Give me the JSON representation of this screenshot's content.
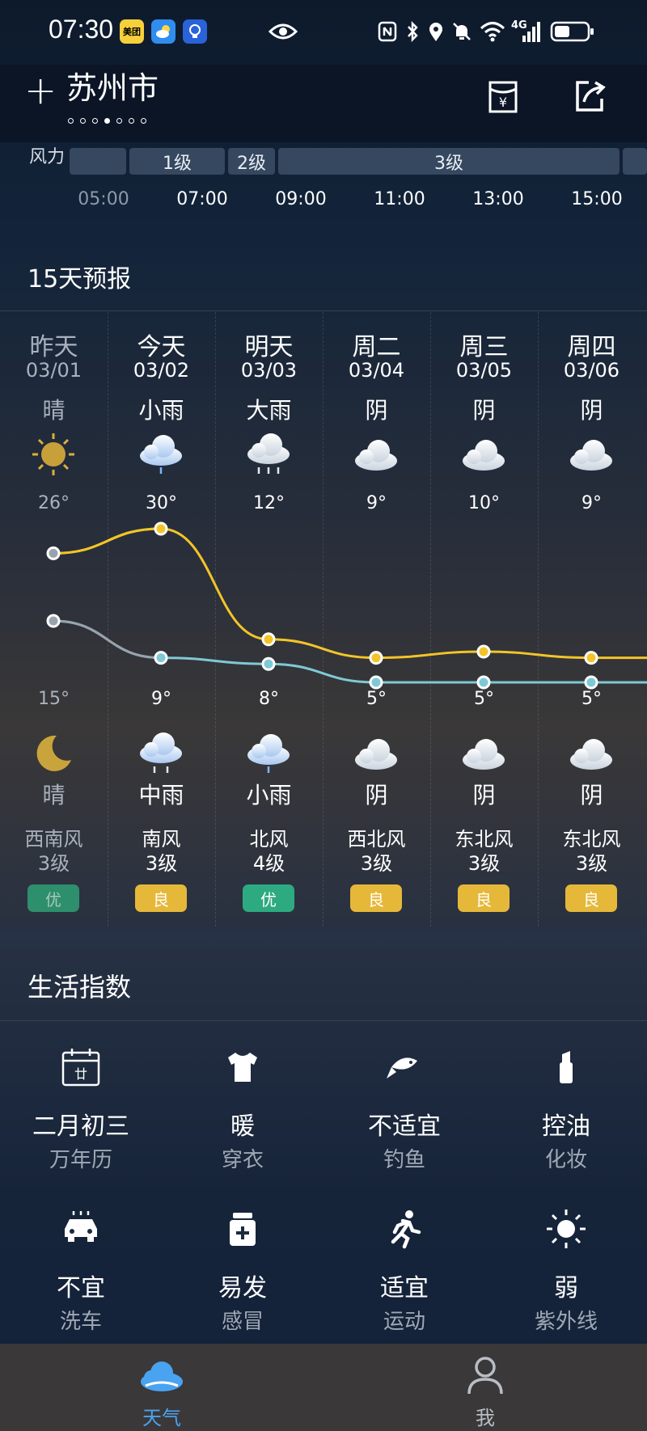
{
  "status_bar": {
    "time": "07:30",
    "apps": [
      "美团",
      "weather-app-icon",
      "bulb-app-icon"
    ],
    "icons": [
      "eye-icon",
      "nfc-icon",
      "bluetooth-icon",
      "location-icon",
      "mute-icon",
      "wifi-icon",
      "signal-4g-icon",
      "battery-icon"
    ],
    "network": "4G"
  },
  "header": {
    "city": "苏州市",
    "page_count": 7,
    "active_page": 3
  },
  "wind_strip": {
    "label": "风力",
    "levels": [
      "1级",
      "2级",
      "3级"
    ],
    "hours": [
      "05:00",
      "07:00",
      "09:00",
      "11:00",
      "13:00",
      "15:00"
    ]
  },
  "forecast": {
    "title": "15天预报",
    "days": [
      {
        "name": "昨天",
        "date": "03/01",
        "day_weather": "晴",
        "day_icon": "sun-icon",
        "high": "26°",
        "low": "15°",
        "night_icon": "moon-icon",
        "night_weather": "晴",
        "wind_dir": "西南风",
        "wind_level": "3级",
        "aqi": "优",
        "aqi_color": "#2e8f6c",
        "past": true
      },
      {
        "name": "今天",
        "date": "03/02",
        "day_weather": "小雨",
        "day_icon": "light-rain-icon",
        "high": "30°",
        "low": "9°",
        "night_icon": "moderate-rain-icon",
        "night_weather": "中雨",
        "wind_dir": "南风",
        "wind_level": "3级",
        "aqi": "良",
        "aqi_color": "#e6b83a",
        "past": false
      },
      {
        "name": "明天",
        "date": "03/03",
        "day_weather": "大雨",
        "day_icon": "heavy-rain-icon",
        "high": "12°",
        "low": "8°",
        "night_icon": "light-rain-icon",
        "night_weather": "小雨",
        "wind_dir": "北风",
        "wind_level": "4级",
        "aqi": "优",
        "aqi_color": "#2eaa80",
        "past": false
      },
      {
        "name": "周二",
        "date": "03/04",
        "day_weather": "阴",
        "day_icon": "overcast-icon",
        "high": "9°",
        "low": "5°",
        "night_icon": "overcast-icon",
        "night_weather": "阴",
        "wind_dir": "西北风",
        "wind_level": "3级",
        "aqi": "良",
        "aqi_color": "#e6b83a",
        "past": false
      },
      {
        "name": "周三",
        "date": "03/05",
        "day_weather": "阴",
        "day_icon": "overcast-icon",
        "high": "10°",
        "low": "5°",
        "night_icon": "overcast-icon",
        "night_weather": "阴",
        "wind_dir": "东北风",
        "wind_level": "3级",
        "aqi": "良",
        "aqi_color": "#e6b83a",
        "past": false
      },
      {
        "name": "周四",
        "date": "03/06",
        "day_weather": "阴",
        "day_icon": "overcast-icon",
        "high": "9°",
        "low": "5°",
        "night_icon": "overcast-icon",
        "night_weather": "阴",
        "wind_dir": "东北风",
        "wind_level": "3级",
        "aqi": "良",
        "aqi_color": "#e6b83a",
        "past": false
      }
    ],
    "temp_colors": {
      "high": "#f2c428",
      "low": "#7fc9d6",
      "past": "#9aa3ad"
    }
  },
  "chart_data": {
    "type": "line",
    "categories": [
      "03/01",
      "03/02",
      "03/03",
      "03/04",
      "03/05",
      "03/06"
    ],
    "series": [
      {
        "values": [
          26,
          30,
          12,
          9,
          10,
          9
        ]
      },
      {
        "values": [
          15,
          9,
          8,
          5,
          5,
          5
        ]
      }
    ],
    "title": "",
    "xlabel": "",
    "ylabel": "",
    "grid": false
  },
  "life_index": {
    "title": "生活指数",
    "items": [
      {
        "value": "二月初三",
        "name": "万年历",
        "icon": "calendar-icon"
      },
      {
        "value": "暖",
        "name": "穿衣",
        "icon": "tshirt-icon"
      },
      {
        "value": "不适宜",
        "name": "钓鱼",
        "icon": "fishing-icon"
      },
      {
        "value": "控油",
        "name": "化妆",
        "icon": "cosmetics-icon"
      },
      {
        "value": "不宜",
        "name": "洗车",
        "icon": "car-wash-icon"
      },
      {
        "value": "易发",
        "name": "感冒",
        "icon": "medicine-icon"
      },
      {
        "value": "适宜",
        "name": "运动",
        "icon": "running-icon"
      },
      {
        "value": "弱",
        "name": "紫外线",
        "icon": "uv-sun-icon"
      }
    ]
  },
  "bottom_nav": {
    "tabs": [
      {
        "label": "天气",
        "icon": "cloud-icon",
        "active": true,
        "color": "#4aa3f0"
      },
      {
        "label": "我",
        "icon": "person-icon",
        "active": false,
        "color": "#b8bec6"
      }
    ]
  }
}
